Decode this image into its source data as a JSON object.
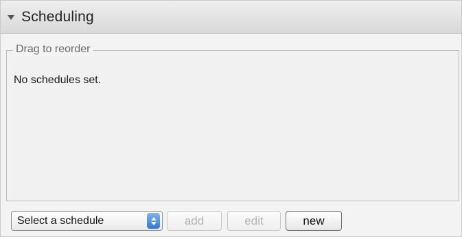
{
  "panel": {
    "title": "Scheduling",
    "group_label": "Drag to reorder",
    "empty_message": "No schedules set."
  },
  "toolbar": {
    "select": {
      "selected": "Select a schedule"
    },
    "add_label": "add",
    "edit_label": "edit",
    "new_label": "new"
  },
  "icons": {
    "disclosure": "disclosure-triangle-down-icon",
    "select_arrows": "up-down-stepper-icon"
  },
  "colors": {
    "select_accent": "#2f78d8",
    "disabled_text": "#b3b3b3"
  }
}
